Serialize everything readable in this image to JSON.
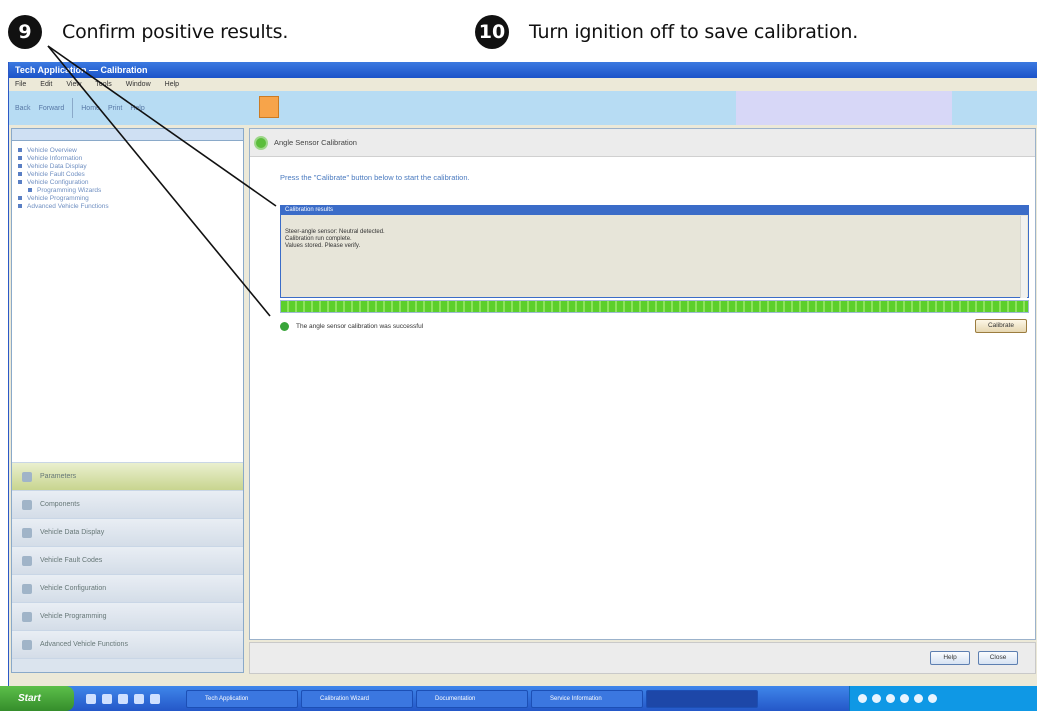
{
  "instructions": [
    {
      "number": "9",
      "text": "Confirm positive results."
    },
    {
      "number": "10",
      "text": "Turn ignition off to save calibration."
    }
  ],
  "app": {
    "title": "Tech Application — Calibration",
    "menu": [
      "File",
      "Edit",
      "View",
      "Tools",
      "Window",
      "Help"
    ],
    "toolbar": [
      "Back",
      "Forward",
      "Home",
      "Print",
      "Help"
    ]
  },
  "tree": [
    "Vehicle Overview",
    "Vehicle Information",
    "Vehicle Data Display",
    "Vehicle Fault Codes",
    "Vehicle Configuration",
    "Programming Wizards",
    "Vehicle Programming",
    "Advanced Vehicle Functions"
  ],
  "nav": [
    {
      "label": "Parameters",
      "active": true
    },
    {
      "label": "Components",
      "active": false
    },
    {
      "label": "Vehicle Data Display",
      "active": false
    },
    {
      "label": "Vehicle Fault Codes",
      "active": false
    },
    {
      "label": "Vehicle Configuration",
      "active": false
    },
    {
      "label": "Vehicle Programming",
      "active": false
    },
    {
      "label": "Advanced Vehicle Functions",
      "active": false
    }
  ],
  "main": {
    "header_title": "Angle Sensor Calibration",
    "prompt": "Press the \"Calibrate\" button below to start the calibration.",
    "results_header": "Calibration results",
    "result_lines": [
      "Steer-angle sensor: Neutral detected.",
      "Calibration run complete.",
      "Values stored. Please verify."
    ],
    "progress_percent": 100,
    "check_message": "The angle sensor calibration was successful",
    "calibrate_label": "Calibrate"
  },
  "footer": {
    "help_label": "Help",
    "close_label": "Close"
  },
  "taskbar": {
    "start_label": "Start",
    "tasks": [
      "Tech Application",
      "Calibration Wizard",
      "Documentation",
      "Service Information"
    ]
  }
}
